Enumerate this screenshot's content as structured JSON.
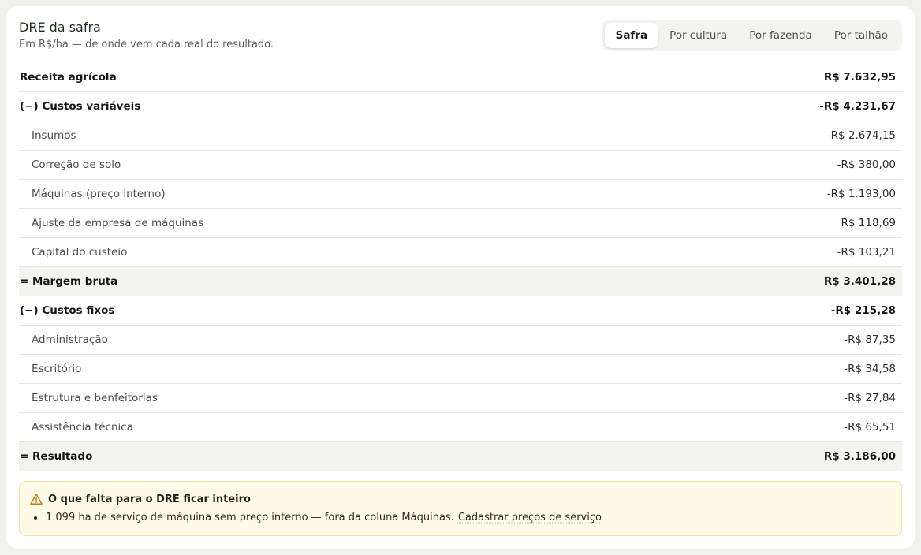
{
  "header": {
    "title": "DRE da safra",
    "subtitle": "Em R$/ha — de onde vem cada real do resultado."
  },
  "tabs": [
    {
      "label": "Safra",
      "active": true
    },
    {
      "label": "Por cultura",
      "active": false
    },
    {
      "label": "Por fazenda",
      "active": false
    },
    {
      "label": "Por talhão",
      "active": false
    }
  ],
  "rows": [
    {
      "label": "Receita agrícola",
      "value": "R$ 7.632,95",
      "kind": "section"
    },
    {
      "label": "(−) Custos variáveis",
      "value": "-R$ 4.231,67",
      "kind": "section"
    },
    {
      "label": "Insumos",
      "value": "-R$ 2.674,15",
      "kind": "sub"
    },
    {
      "label": "Correção de solo",
      "value": "-R$ 380,00",
      "kind": "sub"
    },
    {
      "label": "Máquinas (preço interno)",
      "value": "-R$ 1.193,00",
      "kind": "sub"
    },
    {
      "label": "Ajuste da empresa de máquinas",
      "value": "R$ 118,69",
      "kind": "sub"
    },
    {
      "label": "Capital do custeio",
      "value": "-R$ 103,21",
      "kind": "sub"
    },
    {
      "label": "= Margem bruta",
      "value": "R$ 3.401,28",
      "kind": "total"
    },
    {
      "label": "(−) Custos fixos",
      "value": "-R$ 215,28",
      "kind": "section"
    },
    {
      "label": "Administração",
      "value": "-R$ 87,35",
      "kind": "sub"
    },
    {
      "label": "Escritório",
      "value": "-R$ 34,58",
      "kind": "sub"
    },
    {
      "label": "Estrutura e benfeitorias",
      "value": "-R$ 27,84",
      "kind": "sub"
    },
    {
      "label": "Assistência técnica",
      "value": "-R$ 65,51",
      "kind": "sub"
    },
    {
      "label": "= Resultado",
      "value": "R$ 3.186,00",
      "kind": "total"
    }
  ],
  "alert": {
    "icon": "warning-icon",
    "title": "O que falta para o DRE ficar inteiro",
    "item_text": "1.099 ha de serviço de máquina sem preço interno — fora da coluna Máquinas.",
    "link_text": "Cadastrar preços de serviço"
  },
  "colors": {
    "page_bg": "#f1f1ec",
    "card_bg": "#ffffff",
    "total_row_bg": "#f3f3ef",
    "alert_bg": "#fdfbe7",
    "alert_border": "#efe2a6",
    "warning": "#c77a15"
  }
}
